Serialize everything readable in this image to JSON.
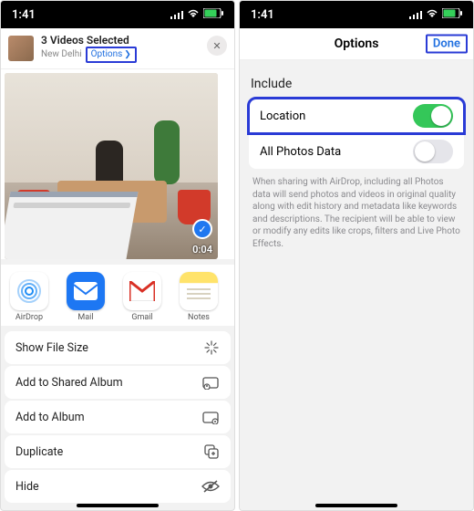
{
  "status": {
    "time": "1:41"
  },
  "left": {
    "header": {
      "title": "3 Videos Selected",
      "subtitle": "New Delhi",
      "options_label": "Options"
    },
    "preview": {
      "duration": "0:04"
    },
    "apps": {
      "airdrop": "AirDrop",
      "mail": "Mail",
      "gmail": "Gmail",
      "notes": "Notes"
    },
    "actions": {
      "show_file_size": "Show File Size",
      "add_shared_album": "Add to Shared Album",
      "add_album": "Add to Album",
      "duplicate": "Duplicate",
      "hide": "Hide"
    }
  },
  "right": {
    "title": "Options",
    "done": "Done",
    "section": "Include",
    "location_label": "Location",
    "all_photos_label": "All Photos Data",
    "hint": "When sharing with AirDrop, including all Photos data will send photos and videos in original quality along with edit history and metadata like keywords and descriptions. The recipient will be able to view or modify any edits like crops, filters and Live Photo Effects."
  }
}
